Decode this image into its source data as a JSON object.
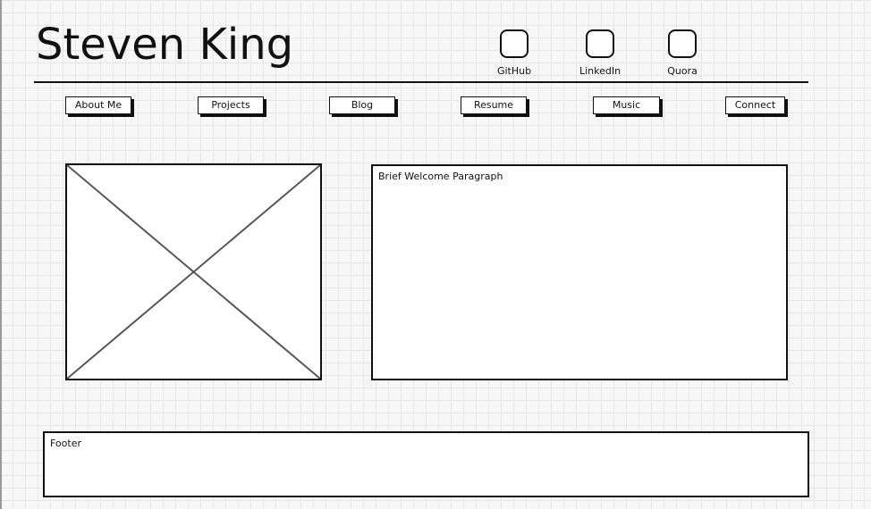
{
  "header": {
    "title": "Steven King"
  },
  "social_links": [
    {
      "label": "GitHub",
      "icon": "github-icon"
    },
    {
      "label": "LinkedIn",
      "icon": "linkedin-icon"
    },
    {
      "label": "Quora",
      "icon": "quora-icon"
    }
  ],
  "nav": {
    "items": [
      {
        "label": "About Me"
      },
      {
        "label": "Projects"
      },
      {
        "label": "Blog"
      },
      {
        "label": "Resume"
      },
      {
        "label": "Music"
      },
      {
        "label": "Connect"
      }
    ]
  },
  "main": {
    "image_placeholder_icon": "image-placeholder-icon",
    "welcome_text": "Brief Welcome Paragraph"
  },
  "footer": {
    "text": "Footer"
  }
}
